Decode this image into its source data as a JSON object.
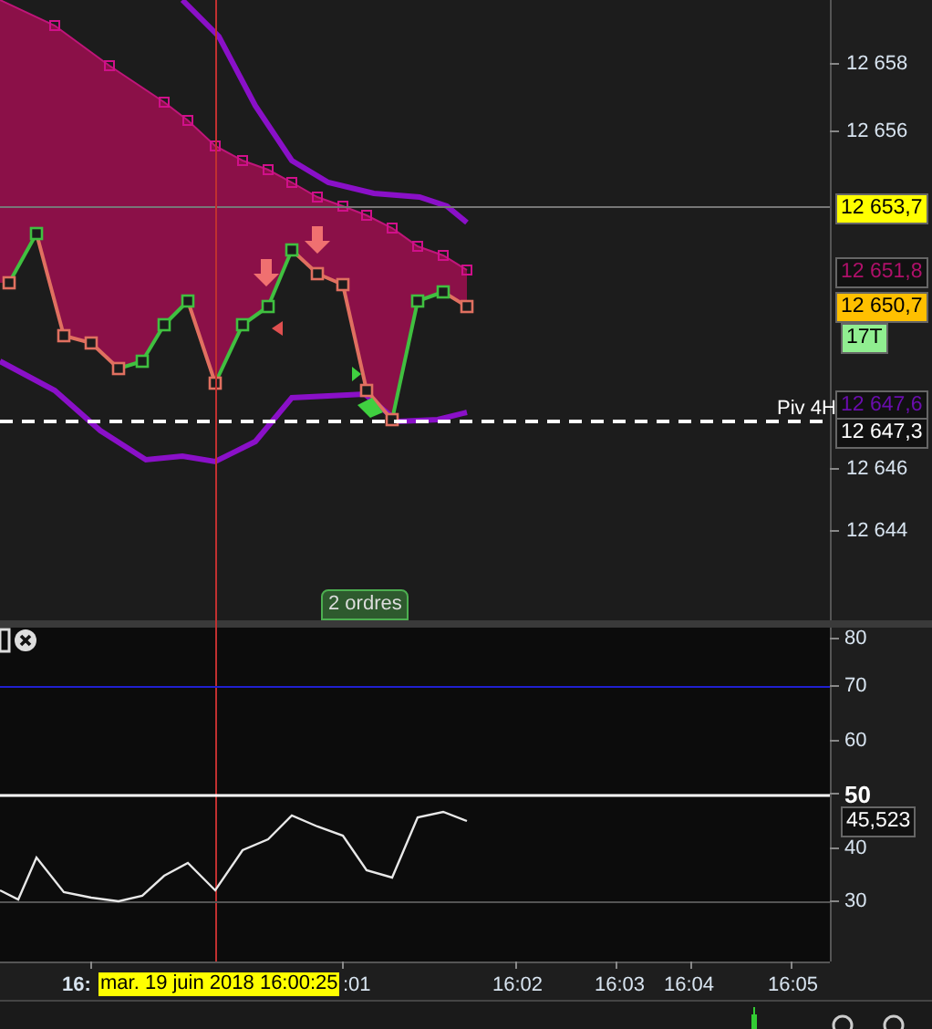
{
  "price_panel": {
    "axis_ticks": [
      "12 658",
      "12 656",
      "12 646",
      "12 644"
    ],
    "price_labels": [
      {
        "text": "12 653,7",
        "kind": "filled",
        "color": "#ffff00"
      },
      {
        "text": "12 651,8",
        "kind": "outlined",
        "color": "#b0106a"
      },
      {
        "text": "12 650,7",
        "kind": "filled",
        "color": "#ffc000"
      },
      {
        "text": "17T",
        "kind": "filled",
        "color": "#90ee90"
      },
      {
        "text": "12 647,6",
        "kind": "outlined",
        "color": "#6a0dad"
      },
      {
        "text": "12 647,3",
        "kind": "outlined",
        "color": "#ffffff"
      }
    ],
    "pivot_label": "Piv 4H",
    "orders_badge": "2 ordres"
  },
  "indicator_panel": {
    "axis_ticks": [
      "80",
      "70",
      "60",
      "50",
      "40",
      "30"
    ],
    "value_label": "45,523"
  },
  "time_axis": {
    "ticks": [
      "16:",
      ":01",
      "16:02",
      "16:03",
      "16:04",
      "16:05"
    ],
    "cursor_tooltip": "mar. 19 juin 2018 16:00:25"
  }
}
